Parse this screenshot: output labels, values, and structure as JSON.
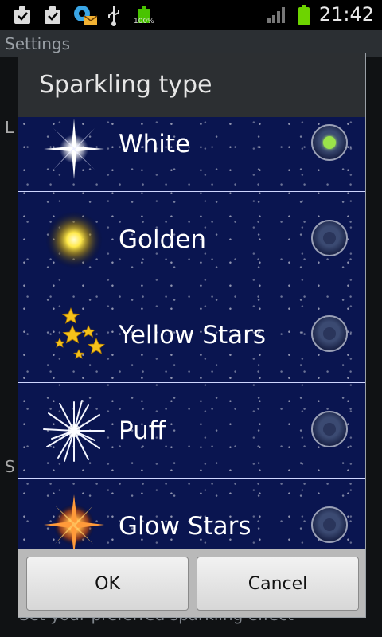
{
  "statusbar": {
    "battery_percent": "100%",
    "time": "21:42",
    "icons": [
      "checklist-icon",
      "checklist-icon",
      "gear-mail-icon",
      "usb-icon",
      "battery-icon",
      "signal-icon",
      "battery-full-icon"
    ]
  },
  "background": {
    "title": "Settings",
    "left_letter_1": "L",
    "left_letter_2": "S",
    "footer": "Set your preferred sparkling effect"
  },
  "dialog": {
    "title": "Sparkling type",
    "items": [
      {
        "label": "White",
        "selected": true
      },
      {
        "label": "Golden",
        "selected": false
      },
      {
        "label": "Yellow Stars",
        "selected": false
      },
      {
        "label": "Puff",
        "selected": false
      },
      {
        "label": "Glow Stars",
        "selected": false
      }
    ],
    "ok_label": "OK",
    "cancel_label": "Cancel"
  },
  "colors": {
    "list_background": "#0a1550",
    "radio_selected": "#9be34a"
  }
}
